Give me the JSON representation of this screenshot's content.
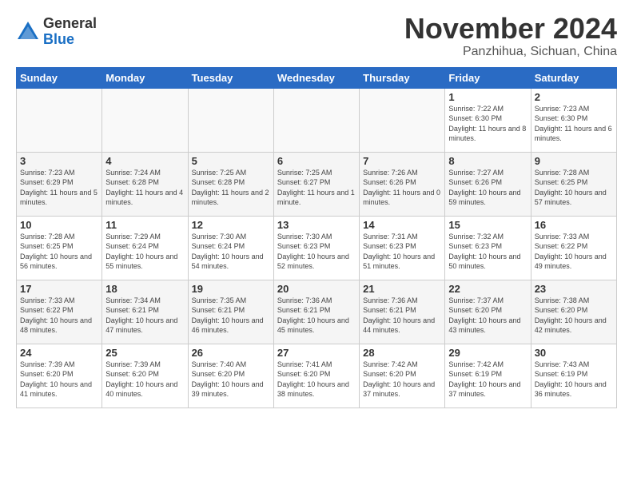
{
  "logo": {
    "general": "General",
    "blue": "Blue"
  },
  "title": "November 2024",
  "location": "Panzhihua, Sichuan, China",
  "weekdays": [
    "Sunday",
    "Monday",
    "Tuesday",
    "Wednesday",
    "Thursday",
    "Friday",
    "Saturday"
  ],
  "weeks": [
    [
      {
        "day": "",
        "info": ""
      },
      {
        "day": "",
        "info": ""
      },
      {
        "day": "",
        "info": ""
      },
      {
        "day": "",
        "info": ""
      },
      {
        "day": "",
        "info": ""
      },
      {
        "day": "1",
        "info": "Sunrise: 7:22 AM\nSunset: 6:30 PM\nDaylight: 11 hours and 8 minutes."
      },
      {
        "day": "2",
        "info": "Sunrise: 7:23 AM\nSunset: 6:30 PM\nDaylight: 11 hours and 6 minutes."
      }
    ],
    [
      {
        "day": "3",
        "info": "Sunrise: 7:23 AM\nSunset: 6:29 PM\nDaylight: 11 hours and 5 minutes."
      },
      {
        "day": "4",
        "info": "Sunrise: 7:24 AM\nSunset: 6:28 PM\nDaylight: 11 hours and 4 minutes."
      },
      {
        "day": "5",
        "info": "Sunrise: 7:25 AM\nSunset: 6:28 PM\nDaylight: 11 hours and 2 minutes."
      },
      {
        "day": "6",
        "info": "Sunrise: 7:25 AM\nSunset: 6:27 PM\nDaylight: 11 hours and 1 minute."
      },
      {
        "day": "7",
        "info": "Sunrise: 7:26 AM\nSunset: 6:26 PM\nDaylight: 11 hours and 0 minutes."
      },
      {
        "day": "8",
        "info": "Sunrise: 7:27 AM\nSunset: 6:26 PM\nDaylight: 10 hours and 59 minutes."
      },
      {
        "day": "9",
        "info": "Sunrise: 7:28 AM\nSunset: 6:25 PM\nDaylight: 10 hours and 57 minutes."
      }
    ],
    [
      {
        "day": "10",
        "info": "Sunrise: 7:28 AM\nSunset: 6:25 PM\nDaylight: 10 hours and 56 minutes."
      },
      {
        "day": "11",
        "info": "Sunrise: 7:29 AM\nSunset: 6:24 PM\nDaylight: 10 hours and 55 minutes."
      },
      {
        "day": "12",
        "info": "Sunrise: 7:30 AM\nSunset: 6:24 PM\nDaylight: 10 hours and 54 minutes."
      },
      {
        "day": "13",
        "info": "Sunrise: 7:30 AM\nSunset: 6:23 PM\nDaylight: 10 hours and 52 minutes."
      },
      {
        "day": "14",
        "info": "Sunrise: 7:31 AM\nSunset: 6:23 PM\nDaylight: 10 hours and 51 minutes."
      },
      {
        "day": "15",
        "info": "Sunrise: 7:32 AM\nSunset: 6:23 PM\nDaylight: 10 hours and 50 minutes."
      },
      {
        "day": "16",
        "info": "Sunrise: 7:33 AM\nSunset: 6:22 PM\nDaylight: 10 hours and 49 minutes."
      }
    ],
    [
      {
        "day": "17",
        "info": "Sunrise: 7:33 AM\nSunset: 6:22 PM\nDaylight: 10 hours and 48 minutes."
      },
      {
        "day": "18",
        "info": "Sunrise: 7:34 AM\nSunset: 6:21 PM\nDaylight: 10 hours and 47 minutes."
      },
      {
        "day": "19",
        "info": "Sunrise: 7:35 AM\nSunset: 6:21 PM\nDaylight: 10 hours and 46 minutes."
      },
      {
        "day": "20",
        "info": "Sunrise: 7:36 AM\nSunset: 6:21 PM\nDaylight: 10 hours and 45 minutes."
      },
      {
        "day": "21",
        "info": "Sunrise: 7:36 AM\nSunset: 6:21 PM\nDaylight: 10 hours and 44 minutes."
      },
      {
        "day": "22",
        "info": "Sunrise: 7:37 AM\nSunset: 6:20 PM\nDaylight: 10 hours and 43 minutes."
      },
      {
        "day": "23",
        "info": "Sunrise: 7:38 AM\nSunset: 6:20 PM\nDaylight: 10 hours and 42 minutes."
      }
    ],
    [
      {
        "day": "24",
        "info": "Sunrise: 7:39 AM\nSunset: 6:20 PM\nDaylight: 10 hours and 41 minutes."
      },
      {
        "day": "25",
        "info": "Sunrise: 7:39 AM\nSunset: 6:20 PM\nDaylight: 10 hours and 40 minutes."
      },
      {
        "day": "26",
        "info": "Sunrise: 7:40 AM\nSunset: 6:20 PM\nDaylight: 10 hours and 39 minutes."
      },
      {
        "day": "27",
        "info": "Sunrise: 7:41 AM\nSunset: 6:20 PM\nDaylight: 10 hours and 38 minutes."
      },
      {
        "day": "28",
        "info": "Sunrise: 7:42 AM\nSunset: 6:20 PM\nDaylight: 10 hours and 37 minutes."
      },
      {
        "day": "29",
        "info": "Sunrise: 7:42 AM\nSunset: 6:19 PM\nDaylight: 10 hours and 37 minutes."
      },
      {
        "day": "30",
        "info": "Sunrise: 7:43 AM\nSunset: 6:19 PM\nDaylight: 10 hours and 36 minutes."
      }
    ]
  ]
}
